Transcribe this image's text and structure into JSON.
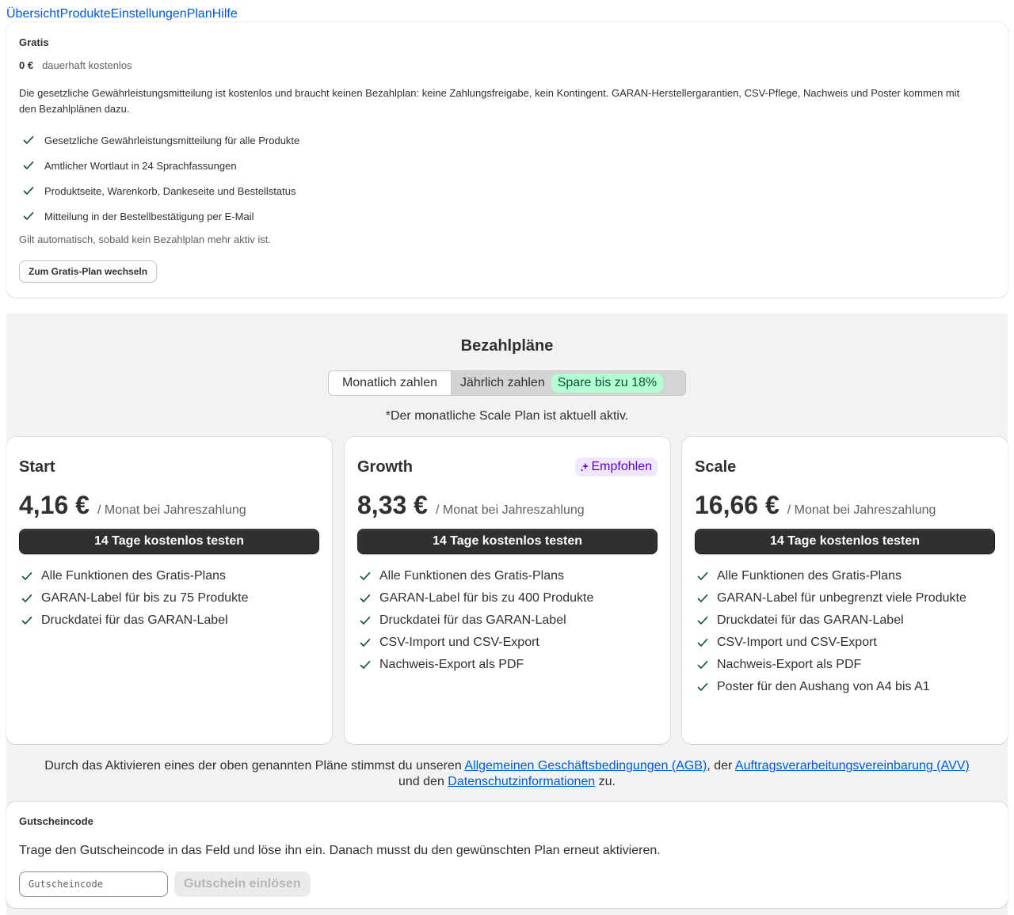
{
  "nav": {
    "items": [
      "Übersicht",
      "Produkte",
      "Einstellungen",
      "Plan",
      "Hilfe"
    ]
  },
  "gratis": {
    "title": "Gratis",
    "price": "0 €",
    "price_note": "dauerhaft kostenlos",
    "description": "Die gesetzliche Gewährleistungsmitteilung ist kostenlos und braucht keinen Bezahlplan: keine Zahlungsfreigabe, kein Kontingent. GARAN-Herstellergarantien, CSV-Pflege, Nachweis und Poster kommen mit den Bezahlplänen dazu.",
    "features": [
      "Gesetzliche Gewährleistungsmitteilung für alle Produkte",
      "Amtlicher Wortlaut in 24 Sprachfassungen",
      "Produktseite, Warenkorb, Dankeseite und Bestellstatus",
      "Mitteilung in der Bestellbestätigung per E-Mail"
    ],
    "auto_note": "Gilt automatisch, sobald kein Bezahlplan mehr aktiv ist.",
    "switch_button": "Zum Gratis-Plan wechseln"
  },
  "paid": {
    "heading": "Bezahlpläne",
    "toggle": {
      "monthly": "Monatlich zahlen",
      "yearly": "Jährlich zahlen",
      "save_badge": "Spare bis zu 18%"
    },
    "active_note": "*Der monatliche Scale Plan ist aktuell aktiv.",
    "plans": [
      {
        "name": "Start",
        "amount": "4,16 €",
        "per": "/ Monat bei Jahreszahlung",
        "button": "14 Tage kostenlos testen",
        "features": [
          "Alle Funktionen des Gratis-Plans",
          "GARAN-Label für bis zu 75 Produkte",
          "Druckdatei für das GARAN-Label"
        ]
      },
      {
        "name": "Growth",
        "badge": "Empfohlen",
        "amount": "8,33 €",
        "per": "/ Monat bei Jahreszahlung",
        "button": "14 Tage kostenlos testen",
        "features": [
          "Alle Funktionen des Gratis-Plans",
          "GARAN-Label für bis zu 400 Produkte",
          "Druckdatei für das GARAN-Label",
          "CSV-Import und CSV-Export",
          "Nachweis-Export als PDF"
        ]
      },
      {
        "name": "Scale",
        "amount": "16,66 €",
        "per": "/ Monat bei Jahreszahlung",
        "button": "14 Tage kostenlos testen",
        "features": [
          "Alle Funktionen des Gratis-Plans",
          "GARAN-Label für unbegrenzt viele Produkte",
          "Druckdatei für das GARAN-Label",
          "CSV-Import und CSV-Export",
          "Nachweis-Export als PDF",
          "Poster für den Aushang von A4 bis A1"
        ]
      }
    ],
    "terms": {
      "part1": "Durch das Aktivieren eines der oben genannten Pläne stimmst du unseren ",
      "link_agb": "Allgemeinen Geschäftsbedingungen (AGB)",
      "part2": ", der ",
      "link_avv": "Auftragsverarbeitungsvereinbarung (AVV)",
      "part3": " und den ",
      "link_privacy": "Datenschutzinformationen",
      "part4": " zu."
    }
  },
  "voucher": {
    "title": "Gutscheincode",
    "description": "Trage den Gutscheincode in das Feld und löse ihn ein. Danach musst du den gewünschten Plan erneut aktivieren.",
    "input_value": "",
    "placeholder": "Gutscheincode",
    "redeem_button": "Gutschein einlösen"
  },
  "colors": {
    "link": "#005bd3",
    "check": "#0c5132",
    "primary_button": "#303030",
    "save_badge_bg": "#b4fed2",
    "recommended_bg": "#f0e7ff",
    "recommended_text": "#5700d1",
    "section_bg": "#f1f2f4"
  },
  "icons": {
    "feature_check": "checkmark-icon",
    "recommended": "sparkle-icon"
  }
}
